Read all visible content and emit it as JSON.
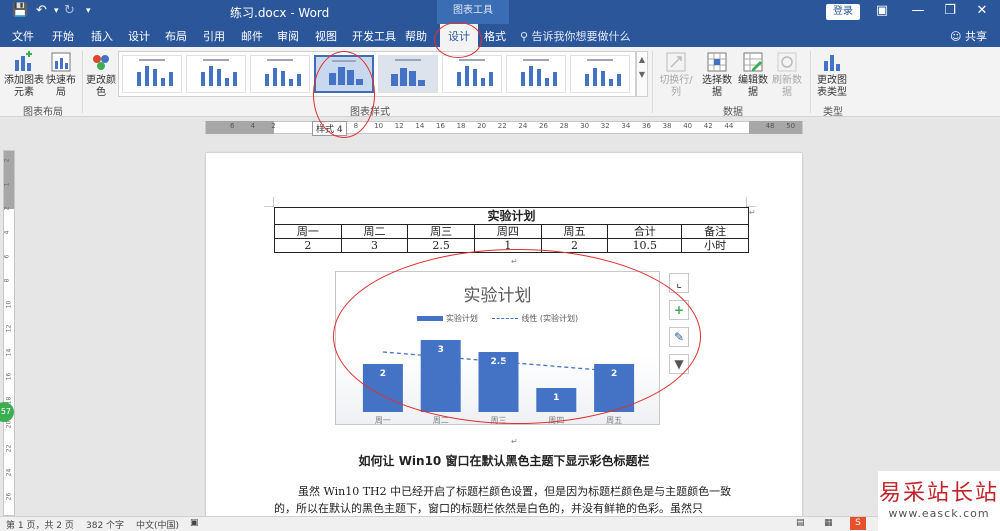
{
  "titlebar": {
    "save_icon": "save-icon",
    "undo_icon": "undo-icon",
    "redo_icon": "redo-icon",
    "doc_title": "练习.docx - Word",
    "context_label": "图表工具",
    "login": "登录"
  },
  "tabs": {
    "file": "文件",
    "home": "开始",
    "insert": "插入",
    "design": "设计",
    "layout": "布局",
    "references": "引用",
    "mailings": "邮件",
    "review": "审阅",
    "view": "视图",
    "developer": "开发工具",
    "help": "帮助",
    "chart_design": "设计",
    "format": "格式",
    "tellme": "告诉我你想要做什么",
    "share": "共享"
  },
  "ribbon": {
    "add_element": "添加图表元素",
    "quick_layout": "快速布局",
    "group_layout": "图表布局",
    "change_colors": "更改颜色",
    "group_styles": "图表样式",
    "switch_row_col": "切换行/列",
    "select_data": "选择数据",
    "edit_data": "编辑数据",
    "refresh_data": "刷新数据",
    "group_data": "数据",
    "change_type": "更改图表类型",
    "group_type": "类型"
  },
  "ruler": {
    "tooltip": "样式 4",
    "ticks": [
      "6",
      "4",
      "2",
      "",
      "2",
      "",
      "8",
      "10",
      "12",
      "14",
      "16",
      "18",
      "20",
      "22",
      "24",
      "26",
      "28",
      "30",
      "32",
      "34",
      "36",
      "38",
      "40",
      "42",
      "44",
      "",
      "48",
      "50"
    ],
    "vticks": [
      "2",
      "1",
      "2",
      "4",
      "6",
      "8",
      "10",
      "12",
      "14",
      "16",
      "18",
      "20",
      "22",
      "24",
      "26"
    ]
  },
  "table": {
    "title": "实验计划",
    "headers": [
      "周一",
      "周二",
      "周三",
      "周四",
      "周五",
      "合计",
      "备注"
    ],
    "values": [
      "2",
      "3",
      "2.5",
      "1",
      "2",
      "10.5",
      "小时"
    ]
  },
  "chart_data": {
    "type": "bar",
    "title": "实验计划",
    "categories": [
      "周一",
      "周二",
      "周三",
      "周四",
      "周五"
    ],
    "series": [
      {
        "name": "实验计划",
        "values": [
          2,
          3,
          2.5,
          1,
          2
        ]
      }
    ],
    "trendline": {
      "name": "线性 (实验计划)",
      "style": "dashed"
    },
    "ylim": [
      0,
      3.5
    ],
    "grid": false,
    "legend": "top",
    "bar_color": "#4472c4"
  },
  "document": {
    "heading": "如何让 Win10 窗口在默认黑色主题下显示彩色标题栏",
    "paragraph": "虽然 Win10 TH2 中已经开启了标题栏颜色设置，但是因为标题栏颜色是与主题颜色一致的，所以在默认的黑色主题下，窗口的标题栏依然是白色的，并没有鲜艳的色彩。虽然只"
  },
  "status": {
    "page": "第 1 页，共 2 页",
    "words": "382 个字",
    "lang": "中文(中国)"
  },
  "side_badge": "57",
  "watermark": {
    "main": "易采站长站",
    "url": "www.easck.com"
  },
  "colors": {
    "word_blue": "#2b579a",
    "annotation_red": "#e03030",
    "bar": "#4472c4"
  }
}
